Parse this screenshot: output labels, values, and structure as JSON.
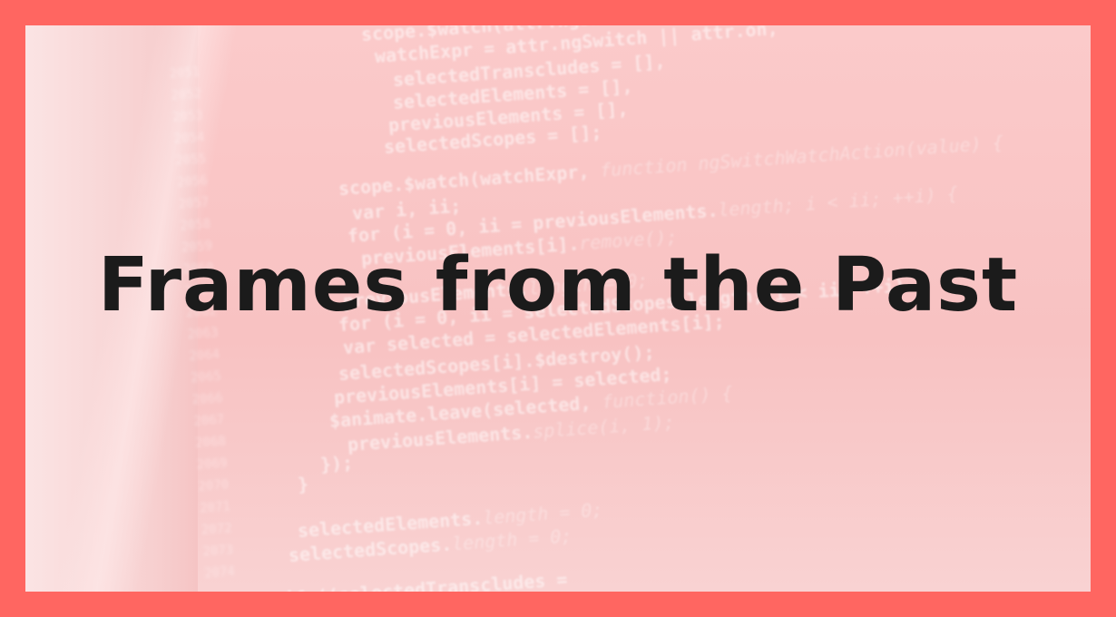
{
  "title": "Frames from the Past",
  "colors": {
    "border": "#ff6661",
    "overlay": "#f9c6c6",
    "title_text": "#1b1b1b"
  },
  "background_code": [
    {
      "text": "scope.$watch(attr.ngSwitch || attr.on,",
      "dim": ""
    },
    {
      "text": "watchExpr = attr.ngSwitch || attr.on,",
      "dim": ""
    },
    {
      "text": "selectedTranscludes = [],",
      "dim": ""
    },
    {
      "text": "selectedElements = [],",
      "dim": ""
    },
    {
      "text": "previousElements = [],",
      "dim": ""
    },
    {
      "text": "selectedScopes = [];",
      "dim": ""
    },
    {
      "text": "scope.$watch(watchExpr, ",
      "dim": "function ngSwitchWatchAction(value) {"
    },
    {
      "text": "var i, ii;",
      "dim": ""
    },
    {
      "text": "for (i = 0, ii = previousElements.",
      "dim": "length; i < ii; ++i) {"
    },
    {
      "text": "previousElements[i].",
      "dim": "remove();"
    },
    {
      "text": "}",
      "dim": ""
    },
    {
      "text": "previousElements.",
      "dim": "length = 0;"
    },
    {
      "text": "for (i = 0, ii = selectedScopes.length; i < ii; ++i) {",
      "dim": ""
    },
    {
      "text": "var selected = selectedElements[i];",
      "dim": ""
    },
    {
      "text": "selectedScopes[i].$destroy();",
      "dim": ""
    },
    {
      "text": "previousElements[i] = selected;",
      "dim": ""
    },
    {
      "text": "$animate.leave(selected, ",
      "dim": "function() {"
    },
    {
      "text": "previousElements.",
      "dim": "splice(i, 1);"
    },
    {
      "text": "});",
      "dim": ""
    },
    {
      "text": "}",
      "dim": ""
    },
    {
      "text": "selectedElements.",
      "dim": "length = 0;"
    },
    {
      "text": "selectedScopes.",
      "dim": "length = 0;"
    },
    {
      "text": "if ((selectedTranscludes = ",
      "dim": ""
    }
  ]
}
